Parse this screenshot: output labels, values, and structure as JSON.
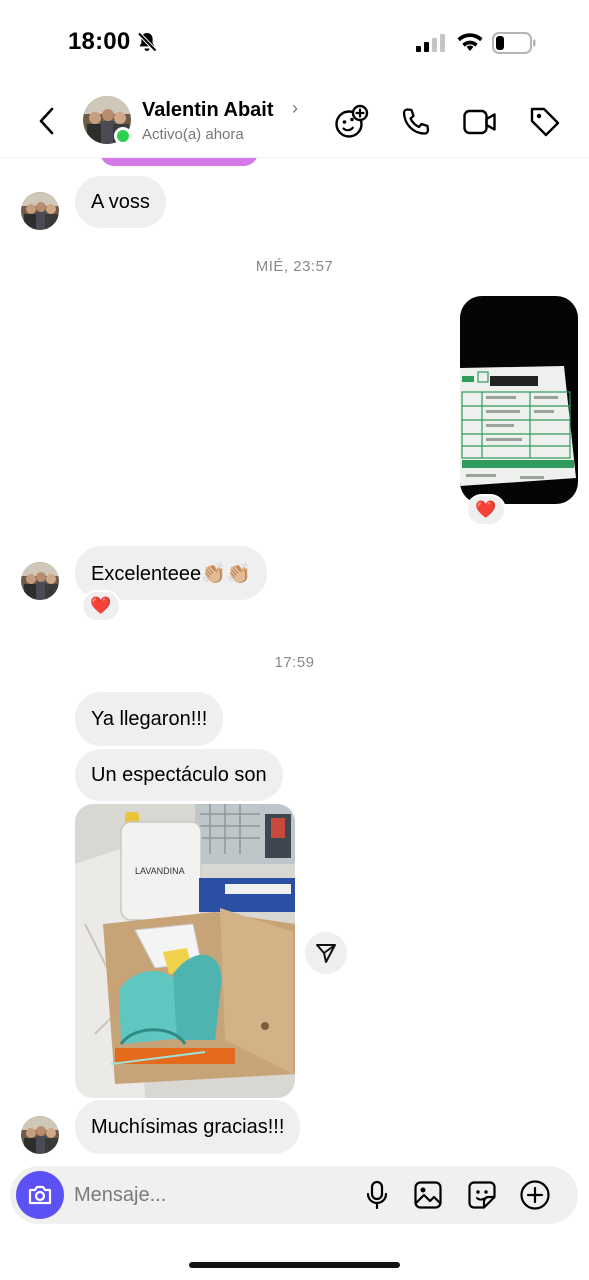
{
  "status_bar": {
    "time": "18:00"
  },
  "header": {
    "contact_name": "Valentin Abait",
    "contact_status": "Activo(a) ahora"
  },
  "chat": {
    "messages": [
      {
        "sender": "them",
        "type": "text",
        "text": "A voss"
      },
      {
        "type": "timestamp",
        "text": "MIÉ, 23:57"
      },
      {
        "sender": "me",
        "type": "image",
        "description": "shipping receipt photo",
        "reaction": "❤️"
      },
      {
        "sender": "them",
        "type": "text",
        "text": "Excelenteee👏🏼👏🏼",
        "reaction": "❤️"
      },
      {
        "type": "timestamp",
        "text": "17:59"
      },
      {
        "sender": "them",
        "type": "text",
        "text": "Ya llegaron!!!"
      },
      {
        "sender": "them",
        "type": "text",
        "text": "Un espectáculo son"
      },
      {
        "sender": "them",
        "type": "image",
        "description": "shoes in box photo"
      },
      {
        "sender": "them",
        "type": "text",
        "text": "Muchísimas gracias!!!"
      }
    ],
    "jug_label": "LAVANDINA"
  },
  "composer": {
    "placeholder": "Mensaje..."
  },
  "colors": {
    "accent": "#5b51f5",
    "online": "#2bd14a",
    "bubble_bg": "#efefef",
    "reaction": "#e5213a"
  }
}
